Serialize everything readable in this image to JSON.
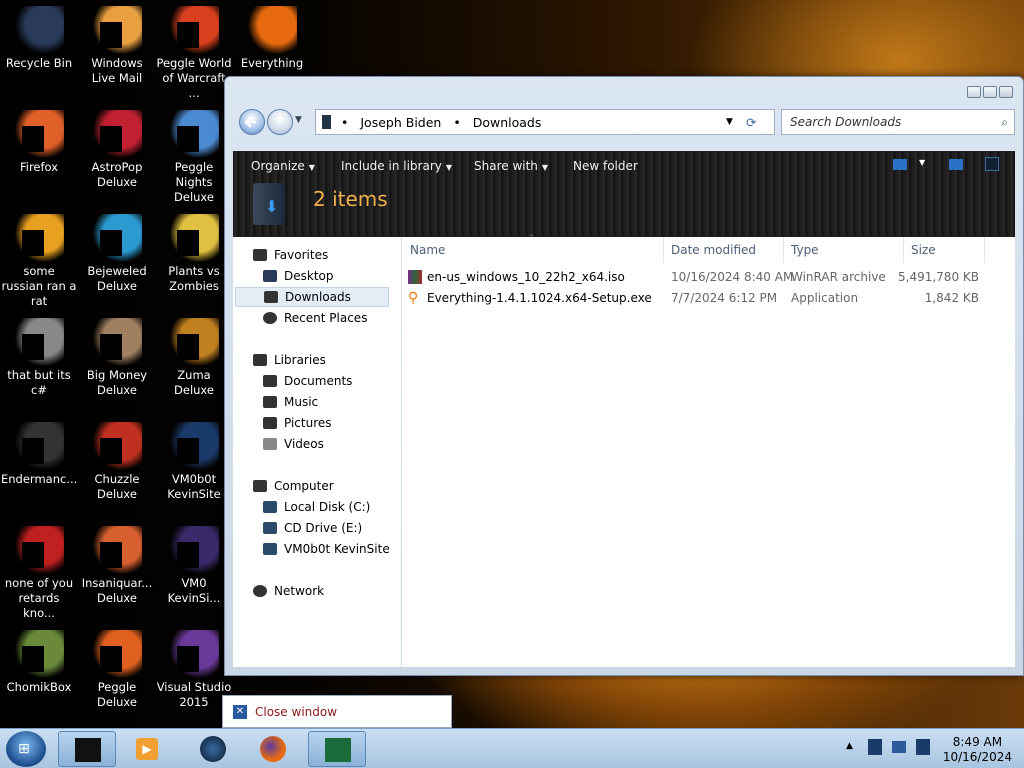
{
  "desktop_icons": [
    {
      "label": "Recycle Bin",
      "icon": "recycle-bin-icon"
    },
    {
      "label": "Windows Live Mail",
      "icon": "mail-icon"
    },
    {
      "label": "Peggle World of Warcraft ...",
      "icon": "peggle-icon"
    },
    {
      "label": "Everything",
      "icon": "everything-icon"
    },
    {
      "label": "Firefox",
      "icon": "firefox-icon"
    },
    {
      "label": "AstroPop Deluxe",
      "icon": "astropop-icon"
    },
    {
      "label": "Peggle Nights Deluxe",
      "icon": "peggle-nights-icon"
    },
    {
      "label": "some russian ran a rat",
      "icon": "app-icon"
    },
    {
      "label": "Bejeweled Deluxe",
      "icon": "bejeweled-icon"
    },
    {
      "label": "Plants vs Zombies",
      "icon": "plants-vs-zombies-icon"
    },
    {
      "label": "that but its c#",
      "icon": "shortcut-icon"
    },
    {
      "label": "Big Money Deluxe",
      "icon": "big-money-icon"
    },
    {
      "label": "Zuma Deluxe",
      "icon": "zuma-icon"
    },
    {
      "label": "Endermanc...",
      "icon": "app-icon"
    },
    {
      "label": "Chuzzle Deluxe",
      "icon": "chuzzle-icon"
    },
    {
      "label": "VM0b0t KevinSite",
      "icon": "vm-icon"
    },
    {
      "label": "none of you retards kno...",
      "icon": "app-icon"
    },
    {
      "label": "Insaniquar... Deluxe",
      "icon": "insaniquarium-icon"
    },
    {
      "label": "VM0 KevinSi...",
      "icon": "vm-icon"
    },
    {
      "label": "ChomikBox",
      "icon": "chomikbox-icon"
    },
    {
      "label": "Peggle Deluxe",
      "icon": "peggle-icon"
    },
    {
      "label": "Visual Studio 2015",
      "icon": "visual-studio-icon"
    }
  ],
  "explorer": {
    "breadcrumb": [
      "Joseph Biden",
      "Downloads"
    ],
    "search_placeholder": "Search Downloads",
    "toolbar": {
      "organize": "Organize",
      "include": "Include in library",
      "share": "Share with",
      "new_folder": "New folder"
    },
    "item_count": "2 items",
    "nav": {
      "favorites": "Favorites",
      "desktop": "Desktop",
      "downloads": "Downloads",
      "recent": "Recent Places",
      "libraries": "Libraries",
      "documents": "Documents",
      "music": "Music",
      "pictures": "Pictures",
      "videos": "Videos",
      "computer": "Computer",
      "local_disk": "Local Disk (C:)",
      "cd_drive": "CD Drive (E:)",
      "vm": "VM0b0t KevinSite",
      "network": "Network"
    },
    "columns": {
      "name": "Name",
      "date": "Date modified",
      "type": "Type",
      "size": "Size"
    },
    "files": [
      {
        "name": "en-us_windows_10_22h2_x64.iso",
        "date": "10/16/2024 8:40 AM",
        "type": "WinRAR archive",
        "size": "5,491,780 KB"
      },
      {
        "name": "Everything-1.4.1.1024.x64-Setup.exe",
        "date": "7/7/2024 6:12 PM",
        "type": "Application",
        "size": "1,842 KB"
      }
    ]
  },
  "popup": {
    "close_window": "Close window"
  },
  "taskbar": {
    "time": "8:49 AM",
    "date": "10/16/2024"
  }
}
